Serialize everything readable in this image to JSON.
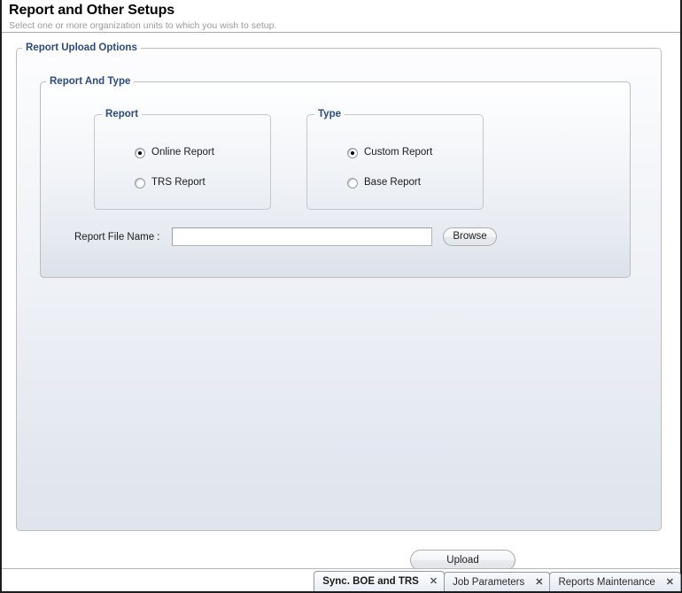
{
  "header": {
    "title": "Report and Other Setups",
    "subtitle": "Select one or more organization units to which you wish to setup."
  },
  "form": {
    "outer_legend": "Report Upload Options",
    "inner_legend": "Report And Type",
    "report_group": {
      "legend": "Report",
      "options": [
        {
          "label": "Online Report",
          "selected": true
        },
        {
          "label": "TRS Report",
          "selected": false
        }
      ]
    },
    "type_group": {
      "legend": "Type",
      "options": [
        {
          "label": "Custom Report",
          "selected": true
        },
        {
          "label": "Base Report",
          "selected": false
        }
      ]
    },
    "file_field": {
      "label": "Report File Name :",
      "value": "",
      "placeholder": ""
    },
    "browse_label": "Browse",
    "upload_label": "Upload"
  },
  "tabs": [
    {
      "label": "Sync. BOE and TRS",
      "active": true,
      "close": "✕"
    },
    {
      "label": "Job Parameters",
      "active": false,
      "close": "✕"
    },
    {
      "label": "Reports Maintenance",
      "active": false,
      "close": "✕"
    }
  ],
  "colors": {
    "legend_blue": "#2c4a7c",
    "panel_bg": "#eef1f6",
    "subtitle_gray": "#9a9a9a"
  }
}
